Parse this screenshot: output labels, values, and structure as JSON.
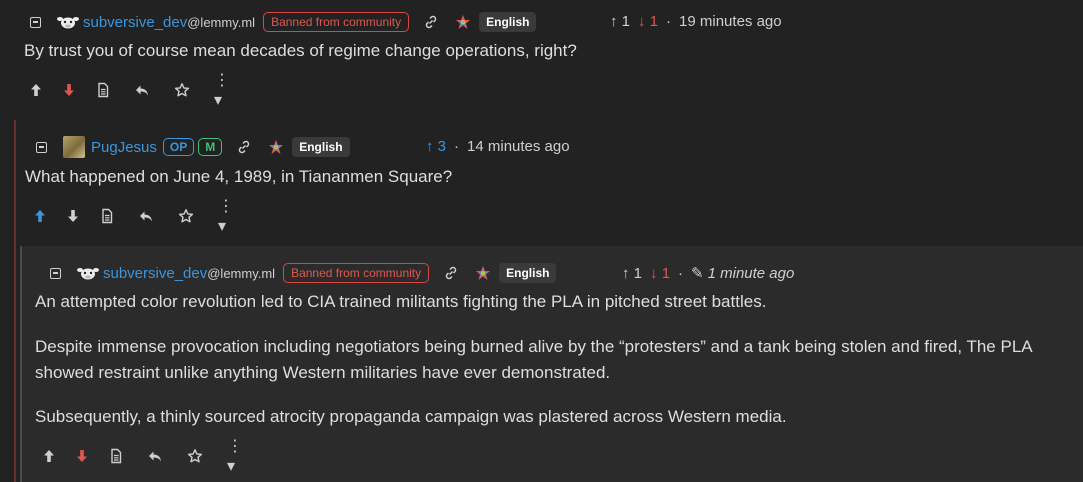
{
  "comments": [
    {
      "username": "subversive_dev",
      "instance": "@lemmy.ml",
      "badge": "Banned from community",
      "language": "English",
      "upvotes": "1",
      "downvotes": "1",
      "time": "19 minutes ago",
      "body": "By trust you of course mean decades of regime change operations, right?"
    },
    {
      "username": "PugJesus",
      "op_badge": "OP",
      "mod_badge": "M",
      "language": "English",
      "upvotes": "3",
      "time": "14 minutes ago",
      "body": "What happened on June 4, 1989, in Tiananmen Square?"
    },
    {
      "username": "subversive_dev",
      "instance": "@lemmy.ml",
      "badge": "Banned from community",
      "language": "English",
      "upvotes": "1",
      "downvotes": "1",
      "time": "1 minute ago",
      "paragraphs": [
        "An attempted color revolution led to CIA trained militants fighting the PLA in pitched street battles.",
        "Despite immense provocation including negotiators being burned alive by the “protesters” and a tank being stolen and fired, The PLA showed restraint unlike anything Western militaries have ever demonstrated.",
        "Subsequently, a thinly sourced atrocity propaganda campaign was plastered across Western media."
      ]
    }
  ],
  "icons": {
    "upvote": "arrow-up-icon",
    "downvote": "arrow-down-icon",
    "source": "document-icon",
    "reply": "reply-icon",
    "save": "star-icon",
    "more": "more-options-icon"
  },
  "colors": {
    "accent": "#3a96dd",
    "danger": "#e0574f",
    "mod": "#3fbf7f",
    "background": "#222222"
  }
}
